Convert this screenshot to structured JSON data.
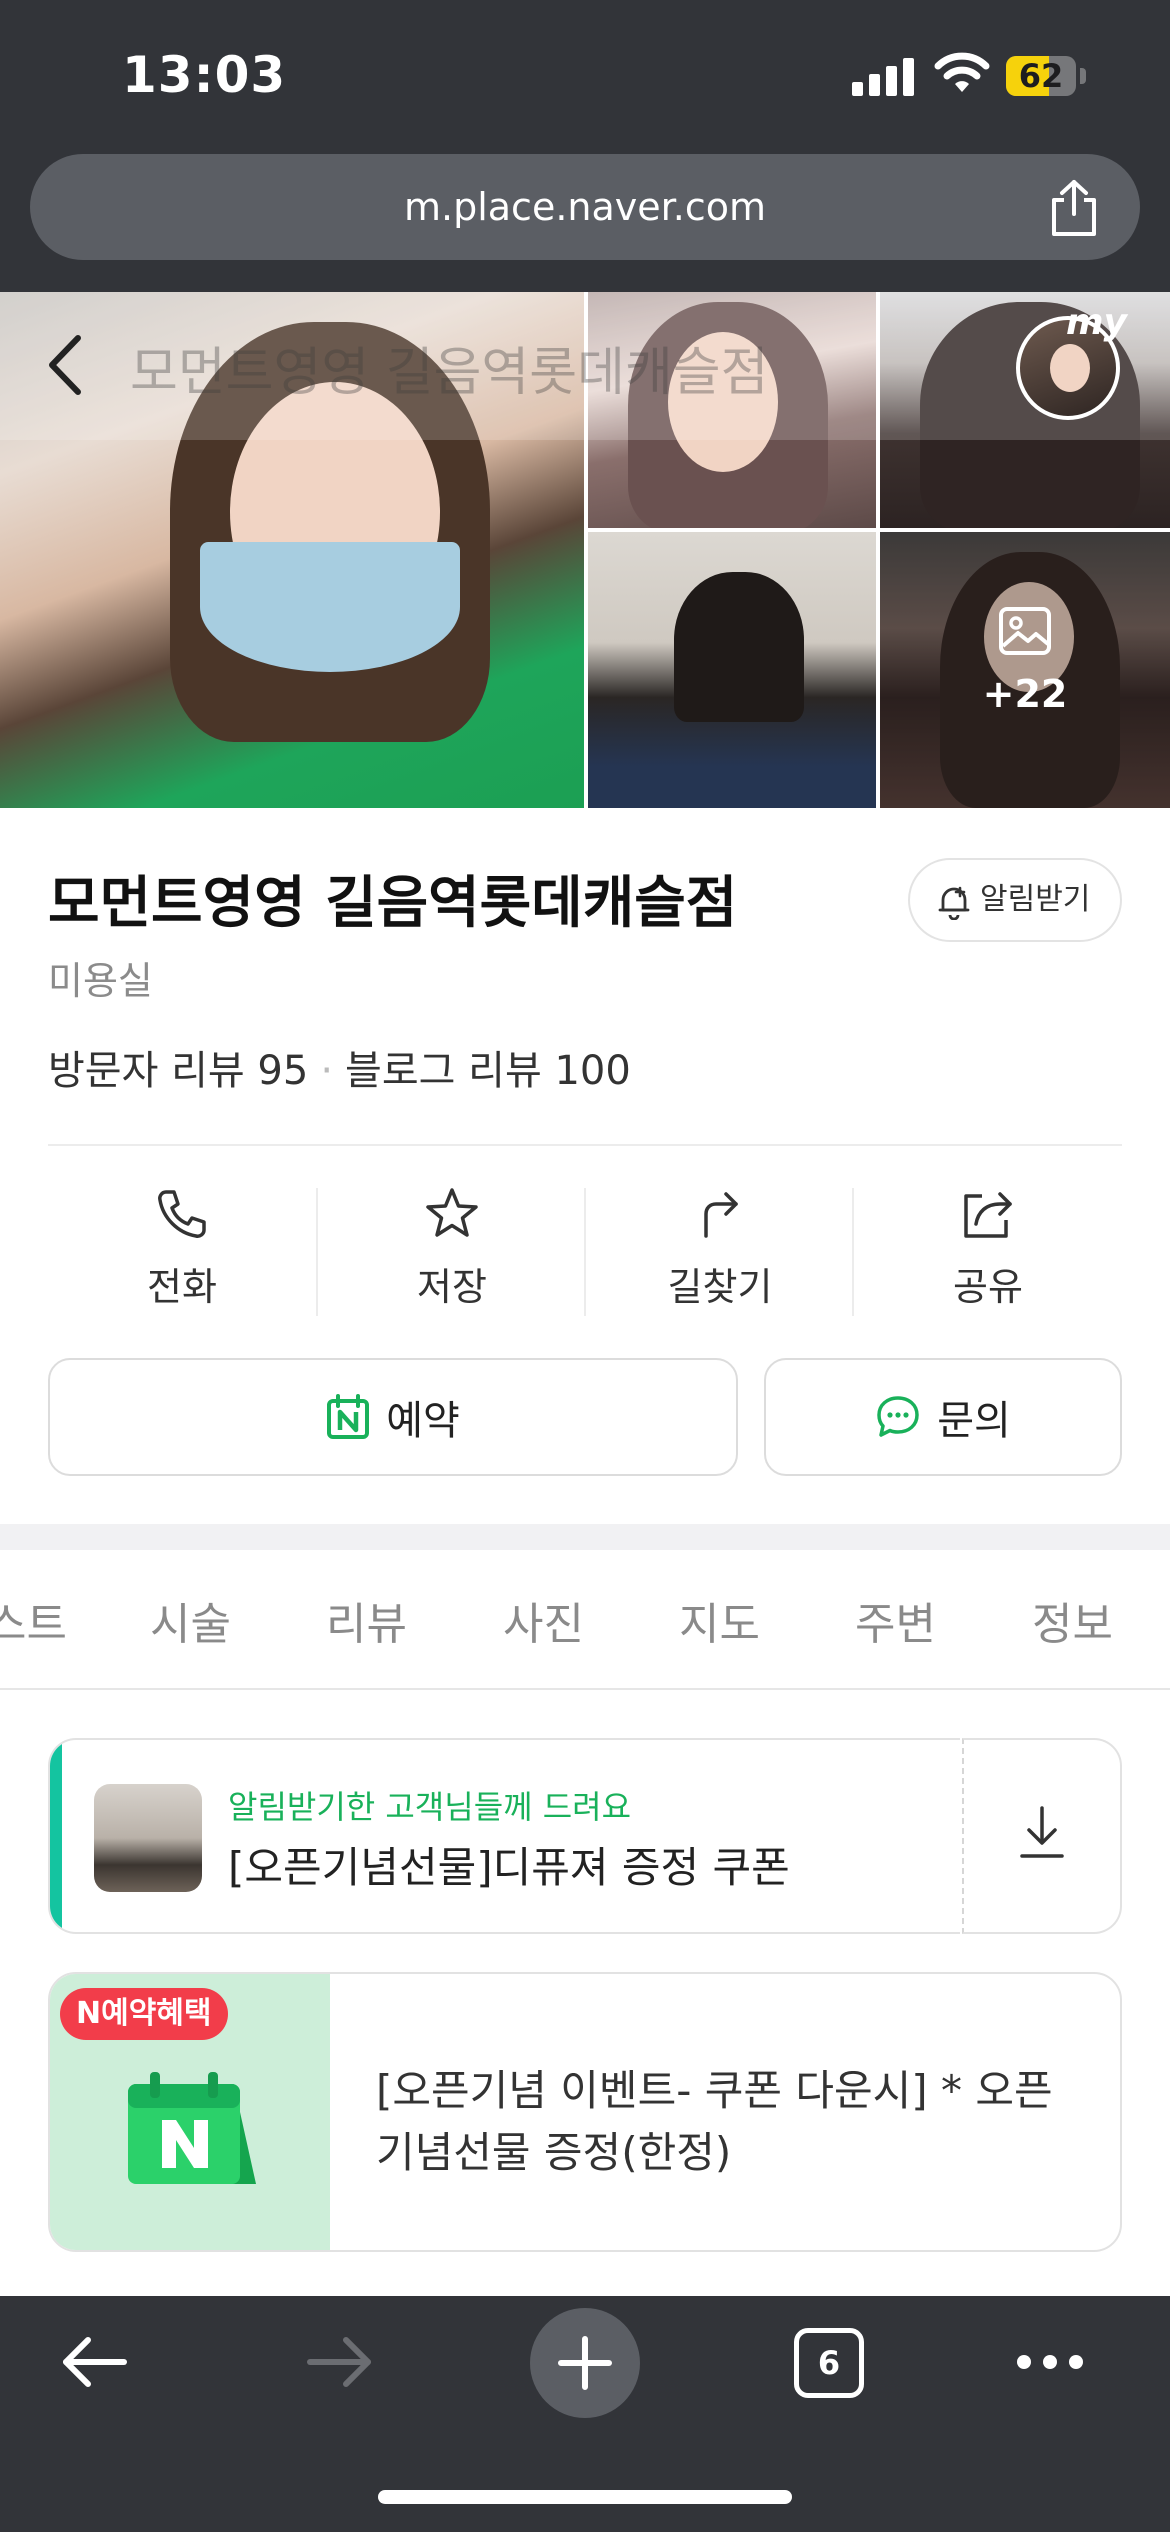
{
  "status_bar": {
    "time": "13:03",
    "battery": "62",
    "battery_level_percent": 62
  },
  "browser": {
    "url": "m.place.naver.com"
  },
  "photos": {
    "more_count": "+22",
    "avatar_label": "my"
  },
  "header": {
    "ghost_title": "모먼트영영 길음역롯데캐슬점"
  },
  "place": {
    "name": "모먼트영영 길음역롯데캐슬점",
    "notify_label": "알림받기",
    "category": "미용실",
    "visitor_reviews": "방문자 리뷰 95",
    "separator": "·",
    "blog_reviews": "블로그 리뷰 100"
  },
  "actions": [
    {
      "label": "전화",
      "icon": "phone-icon"
    },
    {
      "label": "저장",
      "icon": "star-icon"
    },
    {
      "label": "길찾기",
      "icon": "directions-icon"
    },
    {
      "label": "공유",
      "icon": "share-icon"
    }
  ],
  "buttons": {
    "book": "예약",
    "ask": "문의"
  },
  "tabs": [
    "스트",
    "시술",
    "리뷰",
    "사진",
    "지도",
    "주변",
    "정보"
  ],
  "coupon": {
    "subtitle": "알림받기한 고객님들께 드려요",
    "title": "[오픈기념선물]디퓨져 증정 쿠폰"
  },
  "event": {
    "badge": "N예약혜택",
    "text": "[오픈기념 이벤트- 쿠폰 다운시] * 오픈 기념선물 증정(한정)"
  },
  "bottom_toolbar": {
    "tab_count": "6"
  },
  "colors": {
    "brand_green": "#19b15a",
    "coupon_bar": "#14c4a0",
    "badge_red": "#f23d4a",
    "chrome_dark": "#323439",
    "battery_yellow": "#f6d20c"
  }
}
